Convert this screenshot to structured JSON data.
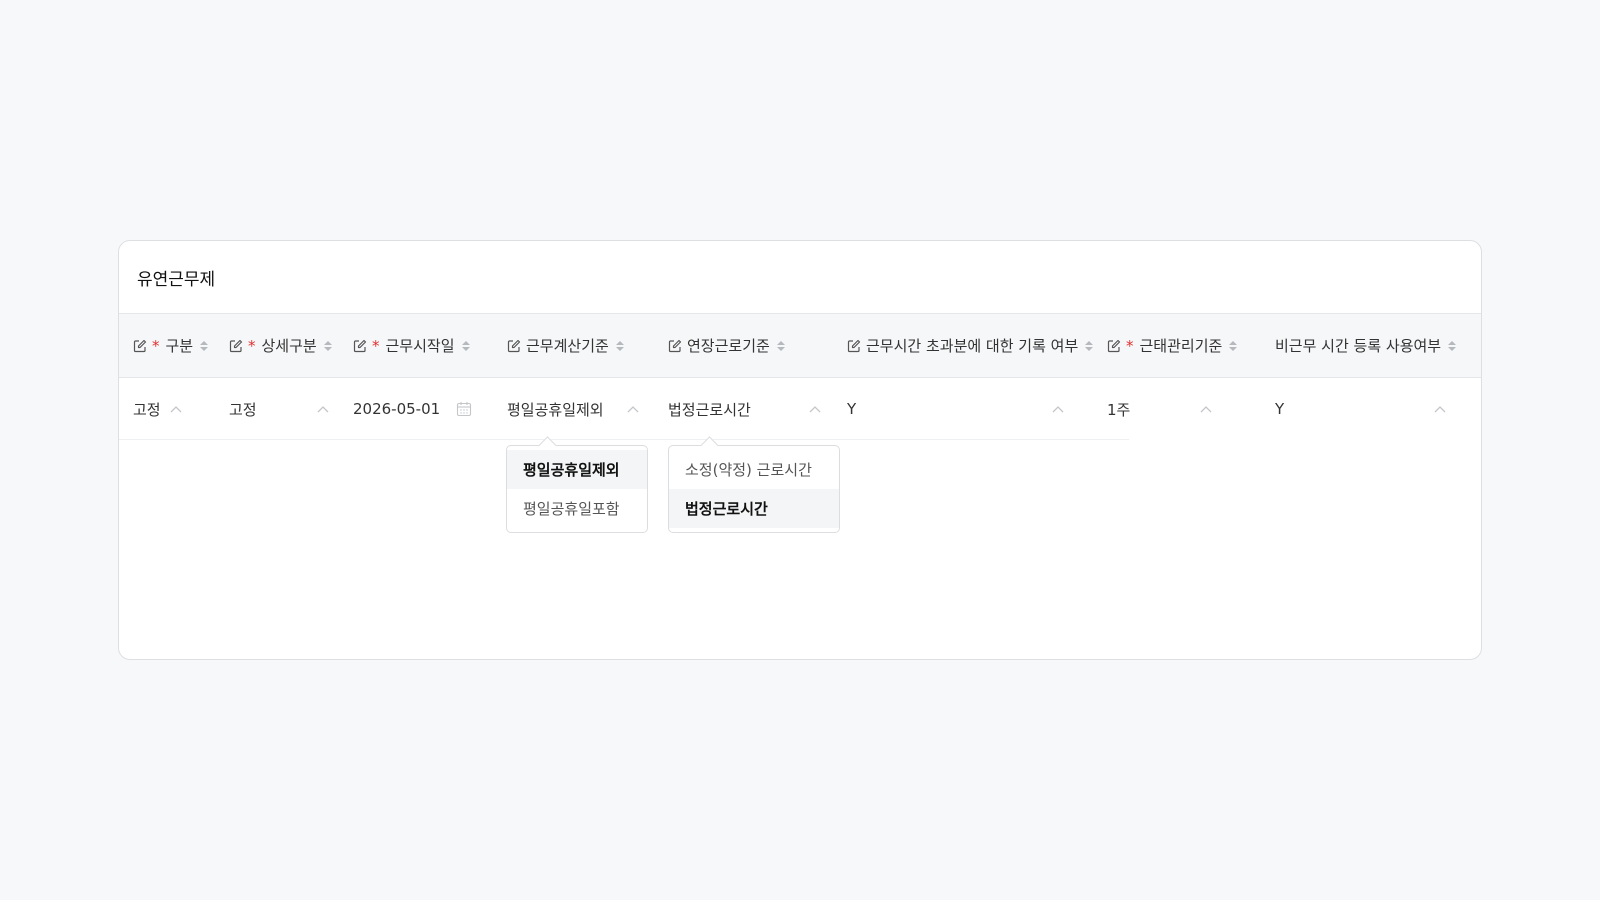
{
  "panel": {
    "title": "유연근무제"
  },
  "columns": [
    {
      "label": "구분",
      "editable": true,
      "required": true,
      "sortable": true
    },
    {
      "label": "상세구분",
      "editable": true,
      "required": true,
      "sortable": true
    },
    {
      "label": "근무시작일",
      "editable": true,
      "required": true,
      "sortable": true
    },
    {
      "label": "근무계산기준",
      "editable": true,
      "required": false,
      "sortable": true
    },
    {
      "label": "연장근로기준",
      "editable": true,
      "required": false,
      "sortable": true
    },
    {
      "label": "근무시간 초과분에 대한 기록 여부",
      "editable": true,
      "required": false,
      "sortable": true
    },
    {
      "label": "근태관리기준",
      "editable": true,
      "required": true,
      "sortable": true
    },
    {
      "label": "비근무 시간 등록 사용여부",
      "editable": false,
      "required": false,
      "sortable": true
    }
  ],
  "row": {
    "type": "고정",
    "detail_type": "고정",
    "start_date": "2026-05-01",
    "calc_basis": "평일공휴일제외",
    "overtime_basis": "법정근로시간",
    "overtime_record": "Y",
    "attendance_basis": "1주",
    "non_work_usage": "Y"
  },
  "dropdowns": {
    "calc_basis": {
      "options": [
        "평일공휴일제외",
        "평일공휴일포함"
      ],
      "selected": "평일공휴일제외"
    },
    "overtime_basis": {
      "options": [
        "소정(약정) 근로시간",
        "법정근로시간"
      ],
      "selected": "법정근로시간"
    }
  },
  "colors": {
    "required_mark": "#e03131",
    "header_bg": "#f6f7f8",
    "page_bg": "#f7f8fa"
  }
}
